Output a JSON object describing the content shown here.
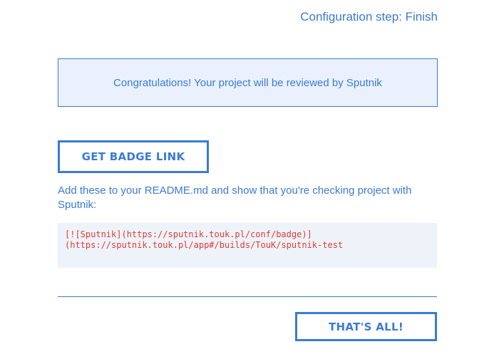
{
  "header": {
    "step_title": "Configuration step: Finish"
  },
  "success": {
    "message": "Congratulations! Your project will be reviewed by Sputnik"
  },
  "badge": {
    "button_label": "GET BADGE LINK",
    "instructions": "Add these to your README.md and show that you're checking project with Sputnik:",
    "code_lines": [
      "[![Sputnik](https://sputnik.touk.pl/conf/badge)]",
      "(https://sputnik.touk.pl/app#/builds/TouK/sputnik-test"
    ]
  },
  "footer": {
    "done_label": "THAT'S ALL!"
  },
  "colors": {
    "accent": "#3a7bd5",
    "panel_bg": "#eaf1fc",
    "code_bg": "#eef3fa",
    "code_text": "#e03c31"
  }
}
